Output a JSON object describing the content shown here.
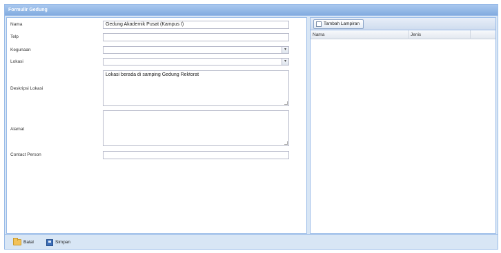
{
  "window": {
    "title": "Formulir Gedung"
  },
  "form": {
    "fields": [
      {
        "label": "Nama",
        "value": "Gedung Akademik Pusat (Kampus I)"
      },
      {
        "label": "Telp",
        "value": ""
      },
      {
        "label": "Kegunaan",
        "value": ""
      },
      {
        "label": "Lokasi",
        "value": ""
      },
      {
        "label": "Deskripsi Lokasi",
        "value": "Lokasi berada di samping Gedung Rektorat"
      },
      {
        "label": "Alamat",
        "value": ""
      },
      {
        "label": "Contact Person",
        "value": ""
      }
    ]
  },
  "attachments": {
    "add_button": "Tambah Lampiran",
    "columns": [
      "Nama",
      "Jenis"
    ]
  },
  "footer": {
    "open_label": "Batal",
    "save_label": "Simpan"
  }
}
